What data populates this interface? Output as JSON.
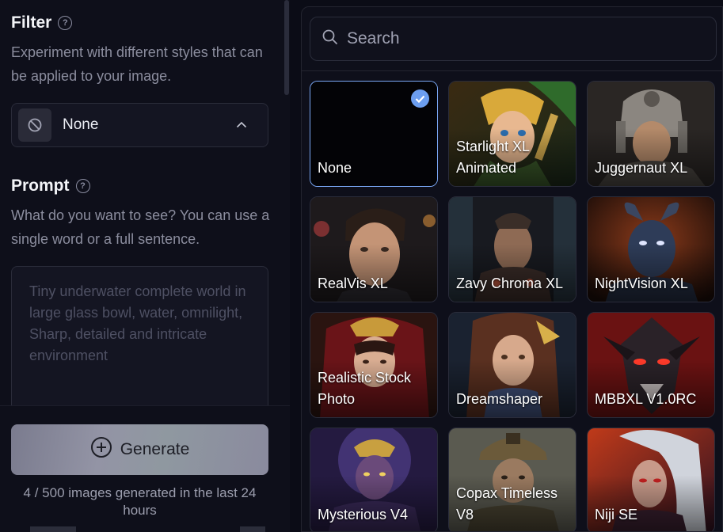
{
  "filter": {
    "heading": "Filter",
    "description": "Experiment with different styles that can be applied to your image.",
    "selected": "None"
  },
  "prompt": {
    "heading": "Prompt",
    "description": "What do you want to see? You can use a single word or a full sentence.",
    "placeholder": "Tiny underwater complete world in large glass bowl, water, omnilight, Sharp, detailed and intricate environment"
  },
  "generate": {
    "label": "Generate",
    "usage": "4 / 500 images generated in the last 24 hours"
  },
  "search": {
    "placeholder": "Search"
  },
  "styles": [
    {
      "name": "None",
      "selected": true
    },
    {
      "name": "Starlight XL Animated",
      "selected": false
    },
    {
      "name": "Juggernaut XL",
      "selected": false
    },
    {
      "name": "RealVis XL",
      "selected": false
    },
    {
      "name": "Zavy Chroma XL",
      "selected": false
    },
    {
      "name": "NightVision XL",
      "selected": false
    },
    {
      "name": "Realistic Stock Photo",
      "selected": false
    },
    {
      "name": "Dreamshaper",
      "selected": false
    },
    {
      "name": "MBBXL V1.0RC",
      "selected": false
    },
    {
      "name": "Mysterious V4",
      "selected": false
    },
    {
      "name": "Copax Timeless V8",
      "selected": false
    },
    {
      "name": "Niji SE",
      "selected": false
    }
  ],
  "colors": {
    "background": "#0b0c16",
    "panel": "#0e0f1a",
    "accent": "#6c9ef0",
    "muted_text": "#8b8d9e"
  }
}
